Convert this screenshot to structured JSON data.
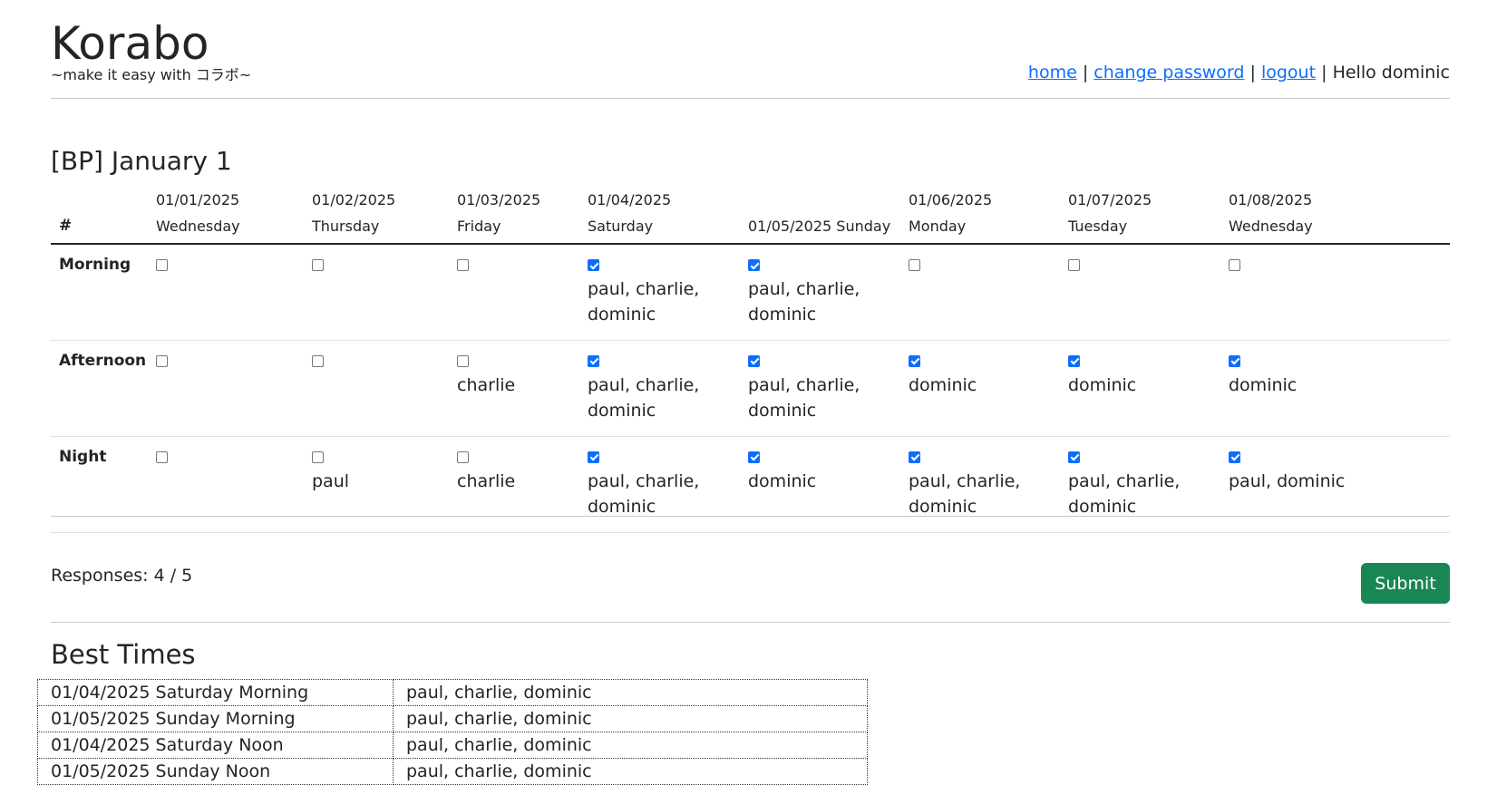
{
  "brand": {
    "title": "Korabo",
    "tagline": "~make it easy with コラボ~"
  },
  "nav": {
    "home": "home",
    "sep": "|",
    "change_password": "change password",
    "logout": "logout",
    "greeting": "Hello dominic"
  },
  "page_title": "[BP] January 1",
  "table": {
    "hash": "#",
    "days": [
      {
        "date": "01/01/2025",
        "weekday": "Wednesday",
        "label": "01/01/2025 Wednesday"
      },
      {
        "date": "01/02/2025",
        "weekday": "Thursday",
        "label": "01/02/2025 Thursday"
      },
      {
        "date": "01/03/2025",
        "weekday": "Friday",
        "label": "01/03/2025 Friday"
      },
      {
        "date": "01/04/2025",
        "weekday": "Saturday",
        "label": "01/04/2025 Saturday"
      },
      {
        "date": "01/05/2025",
        "weekday": "Sunday",
        "label": "01/05/2025 Sunday"
      },
      {
        "date": "01/06/2025",
        "weekday": "Monday",
        "label": "01/06/2025 Monday"
      },
      {
        "date": "01/07/2025",
        "weekday": "Tuesday",
        "label": "01/07/2025 Tuesday"
      },
      {
        "date": "01/08/2025",
        "weekday": "Wednesday",
        "label": "01/08/2025 Wednesday"
      }
    ],
    "rows": [
      {
        "label": "Morning",
        "cells": [
          {
            "checked": false,
            "names": ""
          },
          {
            "checked": false,
            "names": ""
          },
          {
            "checked": false,
            "names": ""
          },
          {
            "checked": true,
            "names": "paul, charlie, dominic"
          },
          {
            "checked": true,
            "names": "paul, charlie, dominic"
          },
          {
            "checked": false,
            "names": ""
          },
          {
            "checked": false,
            "names": ""
          },
          {
            "checked": false,
            "names": ""
          }
        ]
      },
      {
        "label": "Afternoon",
        "cells": [
          {
            "checked": false,
            "names": ""
          },
          {
            "checked": false,
            "names": ""
          },
          {
            "checked": false,
            "names": "charlie"
          },
          {
            "checked": true,
            "names": "paul, charlie, dominic"
          },
          {
            "checked": true,
            "names": "paul, charlie, dominic"
          },
          {
            "checked": true,
            "names": "dominic"
          },
          {
            "checked": true,
            "names": "dominic"
          },
          {
            "checked": true,
            "names": "dominic"
          }
        ]
      },
      {
        "label": "Night",
        "cells": [
          {
            "checked": false,
            "names": ""
          },
          {
            "checked": false,
            "names": "paul"
          },
          {
            "checked": false,
            "names": "charlie"
          },
          {
            "checked": true,
            "names": "paul, charlie, dominic"
          },
          {
            "checked": true,
            "names": "dominic"
          },
          {
            "checked": true,
            "names": "paul, charlie, dominic"
          },
          {
            "checked": true,
            "names": "paul, charlie, dominic"
          },
          {
            "checked": true,
            "names": "paul, dominic"
          }
        ]
      }
    ]
  },
  "responses": "Responses: 4 / 5",
  "submit_label": "Submit",
  "best_times": {
    "title": "Best Times",
    "rows": [
      {
        "slot": "01/04/2025 Saturday Morning",
        "names": "paul, charlie, dominic"
      },
      {
        "slot": "01/05/2025 Sunday Morning",
        "names": "paul, charlie, dominic"
      },
      {
        "slot": "01/04/2025 Saturday Noon",
        "names": "paul, charlie, dominic"
      },
      {
        "slot": "01/05/2025 Sunday Noon",
        "names": "paul, charlie, dominic"
      }
    ]
  }
}
